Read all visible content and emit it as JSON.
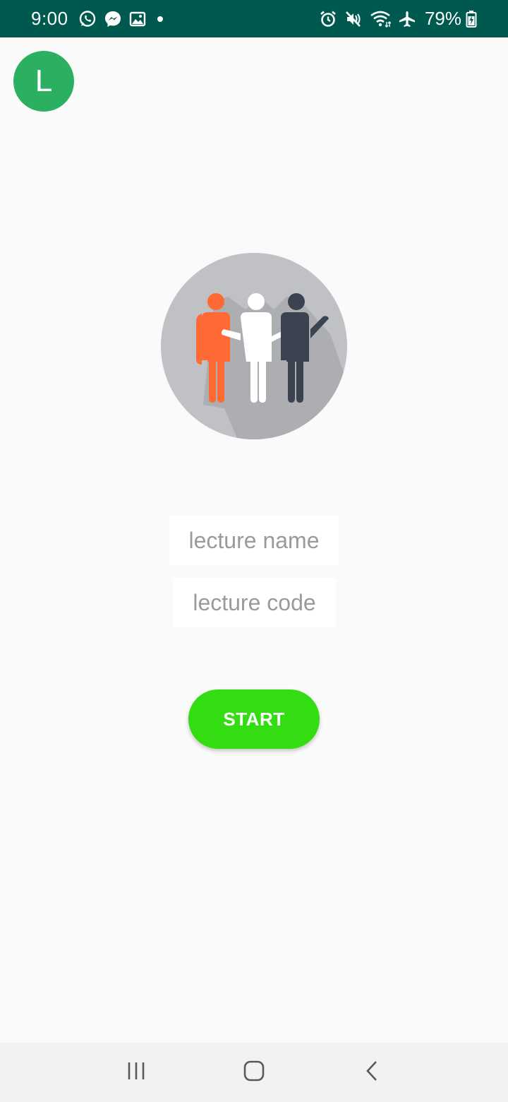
{
  "status_bar": {
    "time": "9:00",
    "battery_percent": "79%",
    "background_color": "#00594f",
    "left_icons": [
      "whatsapp-icon",
      "messenger-icon",
      "gallery-icon",
      "notification-dot-icon"
    ],
    "right_icons": [
      "alarm-icon",
      "mute-vibrate-icon",
      "wifi-icon",
      "airplane-mode-icon",
      "battery-charging-icon"
    ]
  },
  "avatar": {
    "initial": "L",
    "color": "#2bb062"
  },
  "hero": {
    "icon": "group-people-icon",
    "circle_color": "#c0c1c5",
    "person_colors": [
      "#ff6a34",
      "#ffffff",
      "#3b4250"
    ]
  },
  "form": {
    "lecture_name": {
      "value": "",
      "placeholder": "lecture name"
    },
    "lecture_code": {
      "value": "",
      "placeholder": "lecture code"
    },
    "start_label": "START",
    "start_color": "#33dd12"
  },
  "nav_bar": {
    "buttons": [
      "recent-apps-icon",
      "home-icon",
      "back-icon"
    ]
  }
}
